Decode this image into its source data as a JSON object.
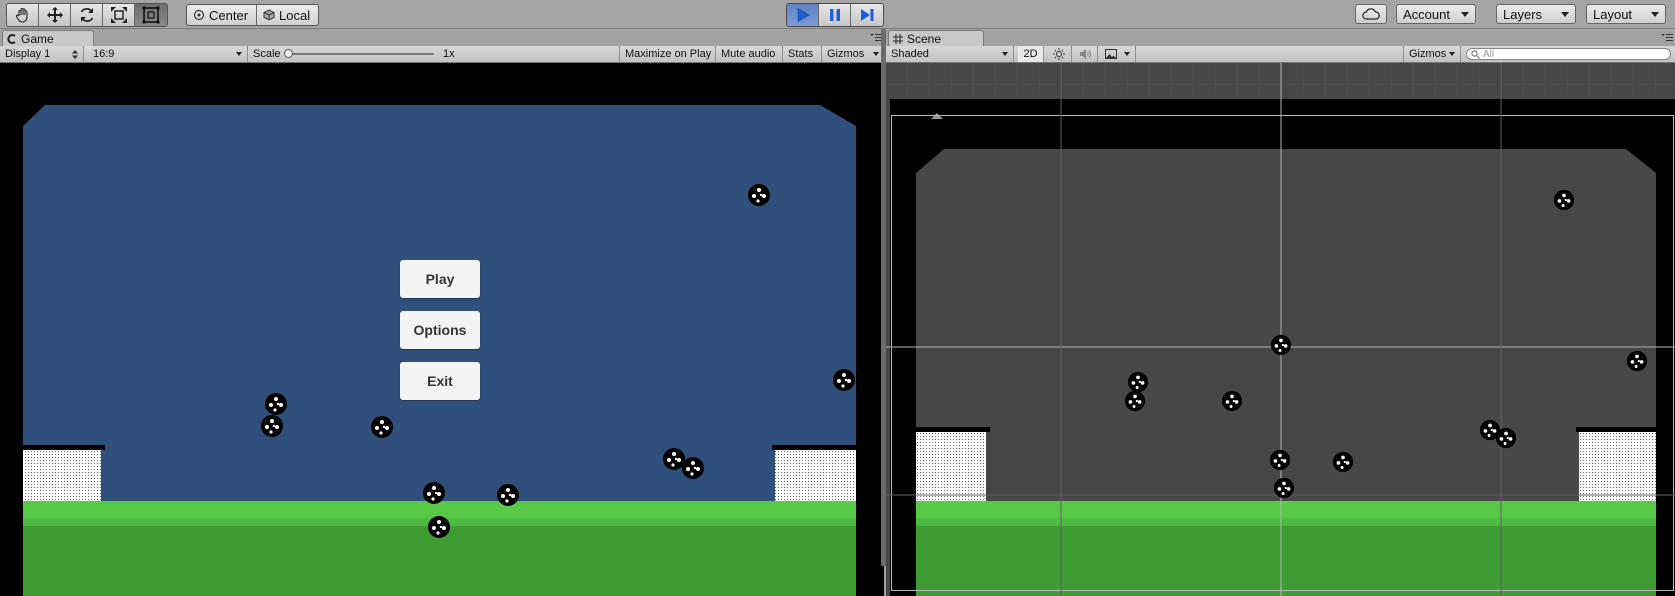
{
  "toolbar": {
    "tools": [
      "hand-tool",
      "move-tool",
      "rotate-tool",
      "scale-tool",
      "rect-tool"
    ],
    "pivot_label": "Center",
    "space_label": "Local",
    "play_controls": [
      "play",
      "pause",
      "step"
    ],
    "account_label": "Account",
    "layers_label": "Layers",
    "layout_label": "Layout"
  },
  "game": {
    "tab_label": "Game",
    "display": "Display 1",
    "aspect": "16:9",
    "scale_label": "Scale",
    "scale_value": "1x",
    "maximize_label": "Maximize on Play",
    "mute_label": "Mute audio",
    "stats_label": "Stats",
    "gizmos_label": "Gizmos",
    "menu": {
      "play": "Play",
      "options": "Options",
      "exit": "Exit"
    }
  },
  "scene": {
    "tab_label": "Scene",
    "shading": "Shaded",
    "mode_2d": "2D",
    "gizmos_label": "Gizmos",
    "search_placeholder": "All"
  },
  "colors": {
    "sky": "#30507c",
    "grass": "#46b23a",
    "scene_bg": "#474747",
    "play_active": "#5f83c7"
  }
}
